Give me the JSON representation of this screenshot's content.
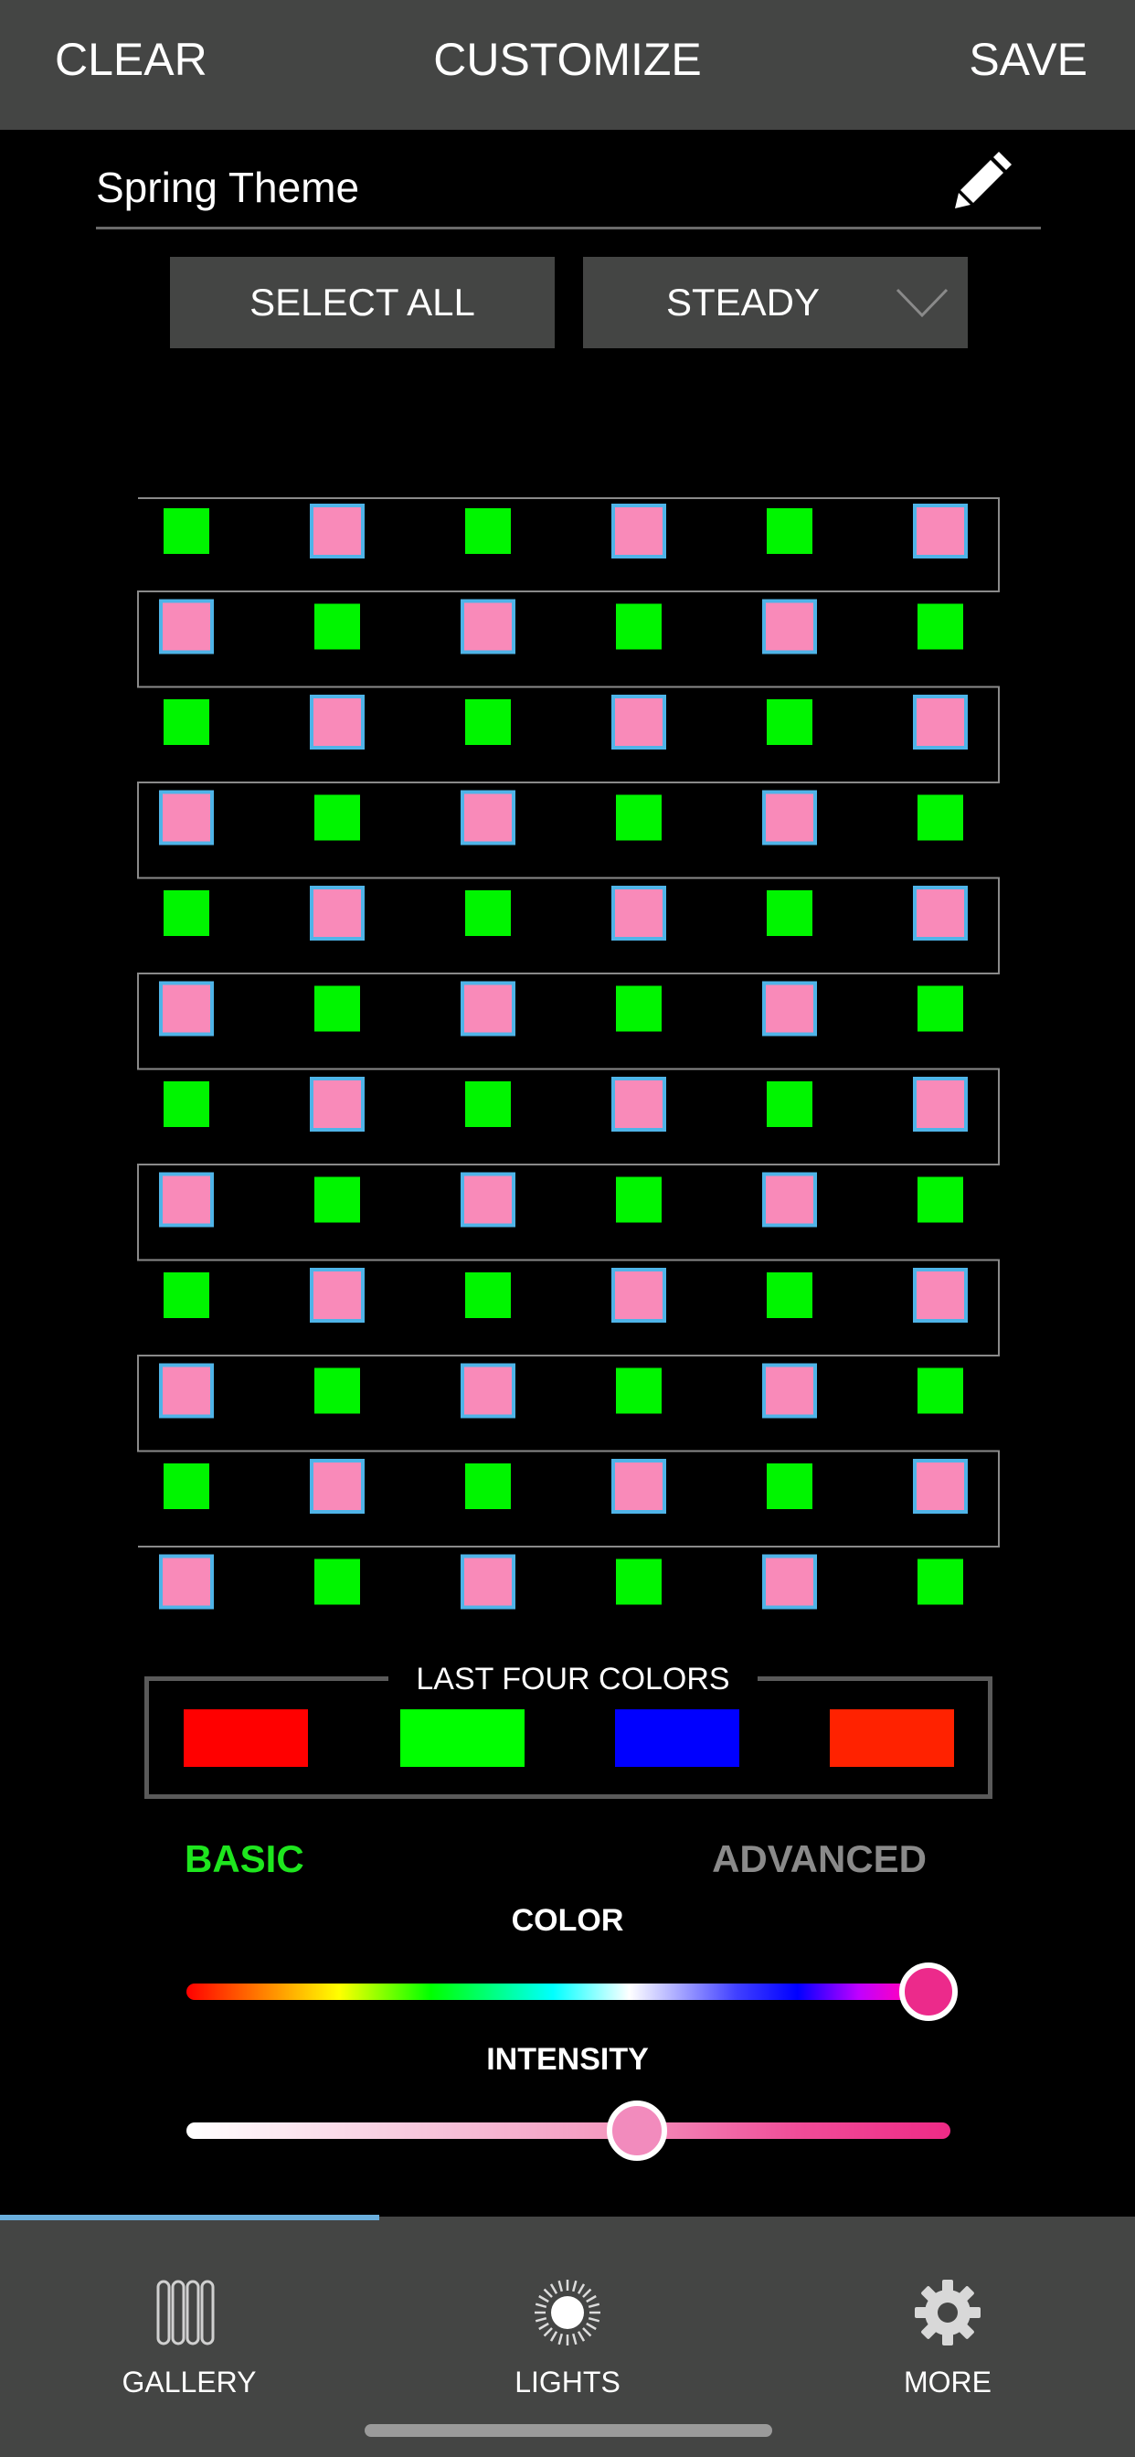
{
  "header": {
    "clear_label": "CLEAR",
    "title": "CUSTOMIZE",
    "save_label": "SAVE"
  },
  "theme": {
    "name": "Spring Theme",
    "edit_icon": "pencil-icon"
  },
  "controls": {
    "select_all_label": "SELECT ALL",
    "mode_value": "STEADY",
    "mode_icon": "chevron-down-icon"
  },
  "light_grid": {
    "rows": 12,
    "columns": 6,
    "pattern_even_rows": [
      "green",
      "pink",
      "green",
      "pink",
      "green",
      "pink"
    ],
    "pattern_odd_rows": [
      "pink",
      "green",
      "pink",
      "green",
      "pink",
      "green"
    ],
    "colors": {
      "green": "#00f500",
      "pink": "#f98ab9",
      "selected_border": "#4fb4e8",
      "wire": "#8a8a8a"
    }
  },
  "recent_colors": {
    "title": "LAST FOUR COLORS",
    "swatches": [
      "#ff0000",
      "#00ff00",
      "#0000ff",
      "#ff2200"
    ]
  },
  "mode_tabs": {
    "basic_label": "BASIC",
    "advanced_label": "ADVANCED",
    "active": "BASIC",
    "active_color": "#1ee61e"
  },
  "sliders": {
    "color_label": "COLOR",
    "color_position": 0.95,
    "color_value": "#ec2a8b",
    "intensity_label": "INTENSITY",
    "intensity_position": 0.59
  },
  "tab_bar": {
    "items": [
      {
        "label": "GALLERY",
        "icon": "gallery-icon"
      },
      {
        "label": "LIGHTS",
        "icon": "light-burst-icon"
      },
      {
        "label": "MORE",
        "icon": "gear-icon"
      }
    ],
    "progress": 0.33
  }
}
